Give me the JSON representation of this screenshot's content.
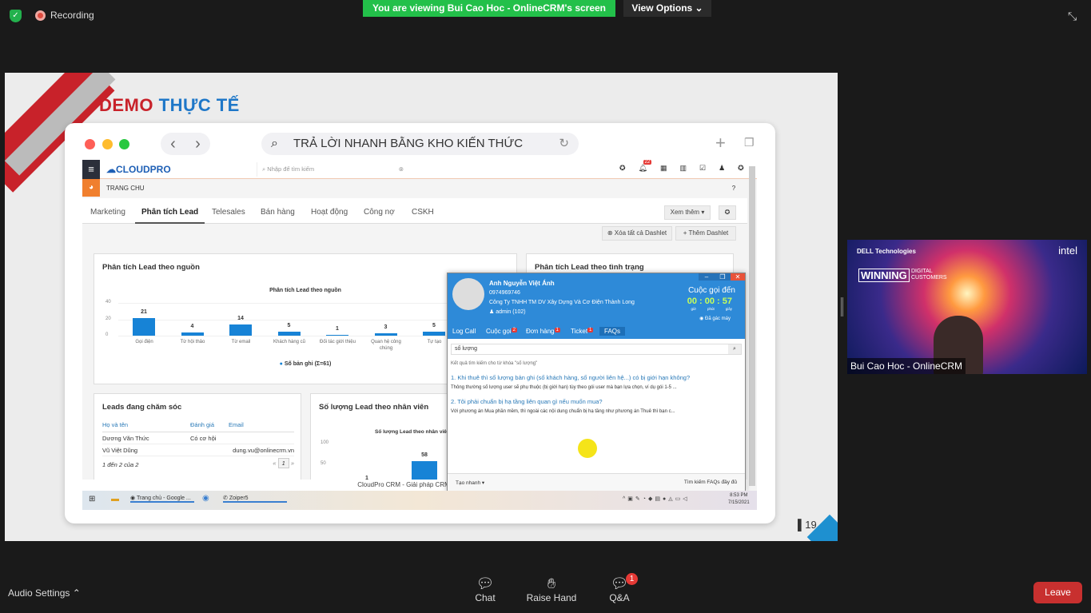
{
  "zoom": {
    "recording_label": "Recording",
    "banner": "You are viewing Bui Cao Hoc - OnlineCRM's screen",
    "view_options": "View Options ⌄",
    "participant_name": "Bui Cao Hoc - OnlineCRM",
    "bottom": {
      "audio_settings": "Audio Settings",
      "chat": "Chat",
      "raise_hand": "Raise Hand",
      "qa": "Q&A",
      "qa_badge": "1",
      "leave": "Leave"
    }
  },
  "slide": {
    "title_part1": "DEMO",
    "title_part2": "THỰC TẾ",
    "page_number": "19",
    "browser_url": "TRẢ LỜI NHANH BẰNG KHO KIẾN THỨC"
  },
  "webcam_background": {
    "brand_left": "DELL Technologies",
    "brand_right": "intel",
    "headline1": "WINNING",
    "headline2": "DIGITAL CUSTOMERS"
  },
  "crm": {
    "logo": "CLOUDPRO",
    "search_placeholder": "Nhập để tìm kiếm",
    "notification_count": "22",
    "breadcrumb": "TRANG CHU",
    "tabs": [
      "Marketing",
      "Phân tích Lead",
      "Telesales",
      "Bán hàng",
      "Hoạt động",
      "Công nợ",
      "CSKH"
    ],
    "active_tab": "Phân tích Lead",
    "more_button": "Xem thêm ▾",
    "clear_dashlets": "Xóa tất cả Dashlet",
    "add_dashlet": "Thêm Dashlet",
    "card_source_title": "Phân tích Lead theo nguồn",
    "card_status_title": "Phân tích Lead theo tình trạng",
    "card_leads_title": "Leads đang chăm sóc",
    "card_staff_title": "Số lượng Lead theo nhân viên",
    "leads_table": {
      "headers": [
        "Họ và tên",
        "Đánh giá",
        "Email"
      ],
      "rows": [
        [
          "Dương Văn Thức",
          "Có cơ hội",
          ""
        ],
        [
          "Vũ Việt Dũng",
          "",
          "dung.vu@onlinecrm.vn"
        ]
      ],
      "pagination": "1 đến 2 của 2",
      "page": "1"
    },
    "footer": "CloudPro CRM - Giải pháp CRM chuyên",
    "popup": {
      "name": "Anh Nguyễn Việt Ánh",
      "phone": "0974969746",
      "company": "Công Ty TNHH TM DV Xây Dựng Và Cơ Điện Thành Long",
      "agent": "admin (102)",
      "call_type": "Cuộc gọi đến",
      "timer": "00 : 00 : 57",
      "timer_units": [
        "giờ",
        "phút",
        "giây"
      ],
      "status": "Đã gác máy",
      "tabs": [
        {
          "label": "Log Call",
          "badge": ""
        },
        {
          "label": "Cuộc gọi",
          "badge": "2"
        },
        {
          "label": "Đơn hàng",
          "badge": "1"
        },
        {
          "label": "Ticket",
          "badge": "1"
        },
        {
          "label": "FAQs",
          "badge": ""
        }
      ],
      "search_value": "số lượng",
      "result_caption": "Kết quả tìm kiếm cho từ khóa \"số lượng\"",
      "results": [
        {
          "q": "1. Khi thuê thì số lượng bản ghi (số khách hàng, số người liên hệ...) có bị giới hạn không?",
          "a": "Thông thường số lượng user sẽ phụ thuộc (bị giới hạn) tùy theo gói user mà bạn lựa chọn, ví dụ gói 1-5 ..."
        },
        {
          "q": "2. Tôi phải chuẩn bị hạ tầng liên quan gì nếu muốn mua?",
          "a": "Với phương án Mua phần mềm, thì ngoài các nội dung chuẩn bị hạ tầng như phương án Thuê thì bạn c..."
        }
      ],
      "quick_create": "Tạo nhanh ▾",
      "search_all": "Tìm kiếm FAQs đầy đủ"
    },
    "taskbar": {
      "items": [
        "Trang chủ - Google ...",
        "Zoiper5"
      ],
      "time": "8:53 PM",
      "date": "7/15/2021"
    }
  },
  "chart_data": [
    {
      "type": "bar",
      "title": "Phân tích Lead theo nguồn",
      "categories": [
        "Gọi điện",
        "Từ hội thảo",
        "Từ email",
        "Khách hàng cũ",
        "Đối tác giới thiệu",
        "Quan hệ công chúng",
        "Tự tạo"
      ],
      "values": [
        21,
        4,
        14,
        5,
        1,
        3,
        5
      ],
      "yticks": [
        0,
        20,
        40
      ],
      "ylim": [
        0,
        40
      ],
      "legend": "Số bản ghi (Σ=61)",
      "legend_position": "bottom",
      "color": "#1783d6"
    },
    {
      "type": "bar",
      "title": "Số lượng Lead theo nhân viên",
      "values": [
        1,
        58
      ],
      "yticks": [
        50,
        100
      ],
      "ylim": [
        0,
        100
      ],
      "color": "#1783d6"
    }
  ]
}
